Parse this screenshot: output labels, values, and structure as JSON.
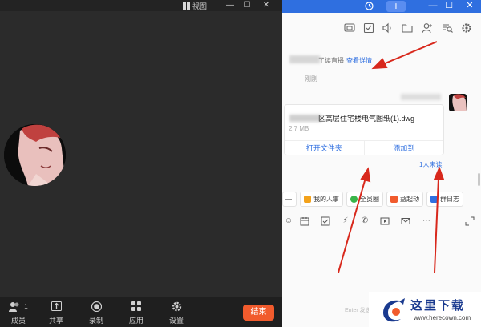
{
  "meeting": {
    "view_label": "视图",
    "window_controls": [
      "—",
      "☐",
      "✕"
    ],
    "toolbar": [
      {
        "label": "成员",
        "icon": "members-icon",
        "badge": "1"
      },
      {
        "label": "共享",
        "icon": "share-icon"
      },
      {
        "label": "录制",
        "icon": "record-icon"
      },
      {
        "label": "应用",
        "icon": "apps-icon"
      },
      {
        "label": "设置",
        "icon": "settings-gear-icon"
      }
    ],
    "end_label": "结束",
    "end_color": "#f15b2d"
  },
  "chat": {
    "accent": "#2f6fe0",
    "top_icons": [
      "history-icon",
      "plus-icon",
      "minimize-icon",
      "maximize-icon",
      "close-icon"
    ],
    "tool_icons": [
      "screen-icon",
      "todo-icon",
      "speaker-icon",
      "folder-icon",
      "add-member-icon",
      "search-doc-icon",
      "settings-icon"
    ],
    "notice": {
      "text": "了读直播",
      "link": "查看详情"
    },
    "time": "刚刚",
    "file": {
      "name": "区高层住宅楼电气图纸(1).dwg",
      "size": "2.7 MB",
      "open_folder": "打开文件夹",
      "add_to": "添加到"
    },
    "unread": "1人未读",
    "quick_apps": [
      {
        "label": "我的人事",
        "icon": "hr-icon",
        "color": "#f3a21b"
      },
      {
        "label": "全员圈",
        "icon": "circle-icon",
        "color": "#39b54a"
      },
      {
        "label": "益起动",
        "icon": "run-icon",
        "color": "#f15b2d"
      },
      {
        "label": "群日志",
        "icon": "log-icon",
        "color": "#2f6fe0"
      }
    ],
    "input_icons": [
      "emoji-icon",
      "calendar-icon",
      "task-icon",
      "flash-icon",
      "call-icon",
      "video-icon",
      "mail-icon",
      "more-icon",
      "expand-icon"
    ],
    "enter_hint": "Enter 发送"
  },
  "watermark": {
    "title": "这里下载",
    "url": "www.herecown.com"
  }
}
